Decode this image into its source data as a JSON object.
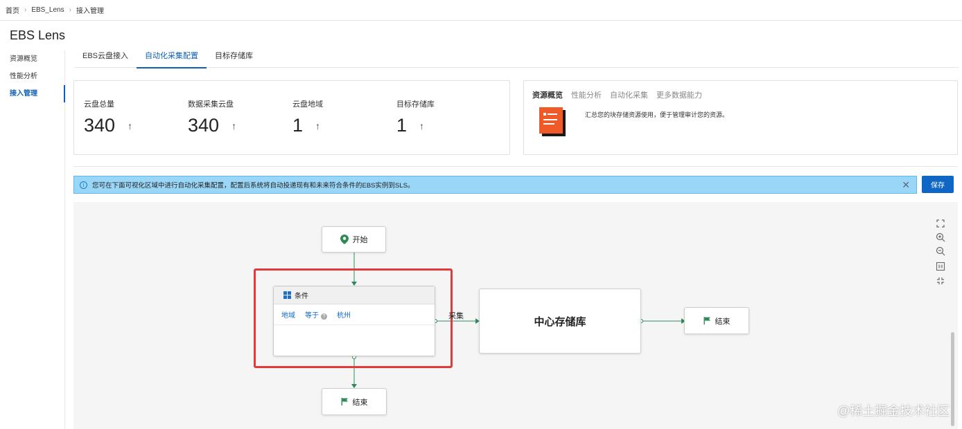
{
  "breadcrumb": [
    "首页",
    "EBS_Lens",
    "接入管理"
  ],
  "page_title": "EBS Lens",
  "sidebar": {
    "items": [
      "资源概览",
      "性能分析",
      "接入管理"
    ],
    "active_index": 2
  },
  "tabs": {
    "items": [
      "EBS云盘接入",
      "自动化采集配置",
      "目标存储库"
    ],
    "active_index": 1
  },
  "stats": [
    {
      "label": "云盘总量",
      "value": "340"
    },
    {
      "label": "数据采集云盘",
      "value": "340"
    },
    {
      "label": "云盘地域",
      "value": "1"
    },
    {
      "label": "目标存储库",
      "value": "1"
    }
  ],
  "overview": {
    "tabs": [
      "资源概览",
      "性能分析",
      "自动化采集",
      "更多数据能力"
    ],
    "description": "汇总您的块存储资源使用，便于管理审计您的资源。"
  },
  "banner": {
    "text": "您可在下面可视化区域中进行自动化采集配置，配置后系统将自动投递现有和未来符合条件的EBS实例到SLS。"
  },
  "save_label": "保存",
  "flow": {
    "start_label": "开始",
    "condition": {
      "title": "条件",
      "field": "地域",
      "operator": "等于",
      "value": "杭州"
    },
    "edge_label": "采集",
    "center_label": "中心存储库",
    "end_label_right": "结束",
    "end_label_bottom": "结束"
  },
  "watermark": "@稀土掘金技术社区",
  "colors": {
    "accent": "#0f66c4",
    "banner_bg": "#9ad6f7",
    "highlight": "#e23a3a",
    "edge": "#2e8b57"
  }
}
